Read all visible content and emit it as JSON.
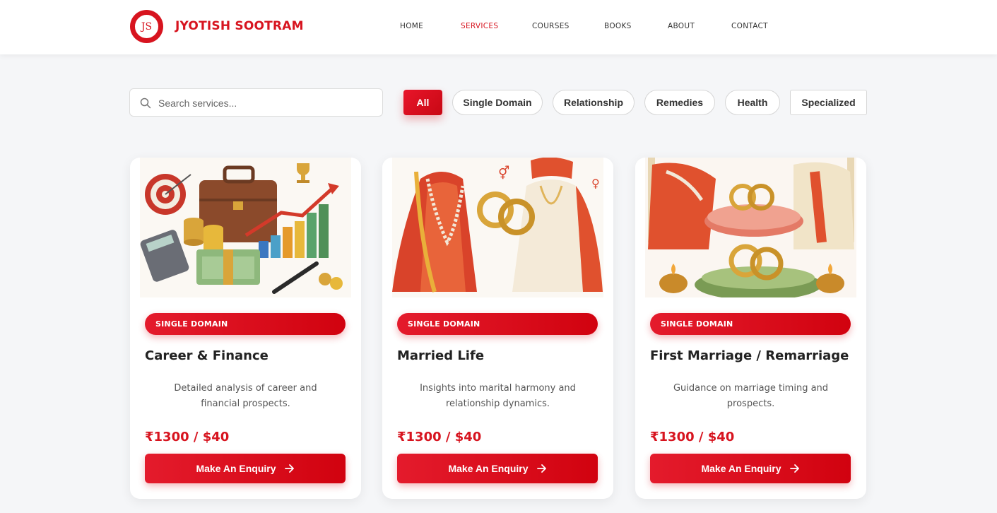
{
  "brand": {
    "name": "JYOTISH SOOTRAM",
    "logo_text": "JS"
  },
  "nav": [
    "HOME",
    "SERVICES",
    "COURSES",
    "BOOKS",
    "ABOUT",
    "CONTACT"
  ],
  "search": {
    "placeholder": "Search services..."
  },
  "filters": [
    "All",
    "Single Domain",
    "Relationship",
    "Remedies",
    "Health",
    "Specialized"
  ],
  "cards": [
    {
      "badge": "SINGLE DOMAIN",
      "title": "Career & Finance",
      "description": "Detailed analysis of career and financial prospects.",
      "price": "₹1300 / $40",
      "button": "Make An Enquiry"
    },
    {
      "badge": "SINGLE DOMAIN",
      "title": "Married Life",
      "description": "Insights into marital harmony and relationship dynamics.",
      "price": "₹1300 / $40",
      "button": "Make An Enquiry"
    },
    {
      "badge": "SINGLE DOMAIN",
      "title": "First Marriage / Remarriage",
      "description": "Guidance on marriage timing and prospects.",
      "price": "₹1300 / $40",
      "button": "Make An Enquiry"
    }
  ],
  "colors": {
    "accent": "#d7141f",
    "background": "#f5f6f8"
  },
  "icons": {
    "search": "search-icon",
    "arrow": "arrow-right-icon"
  }
}
